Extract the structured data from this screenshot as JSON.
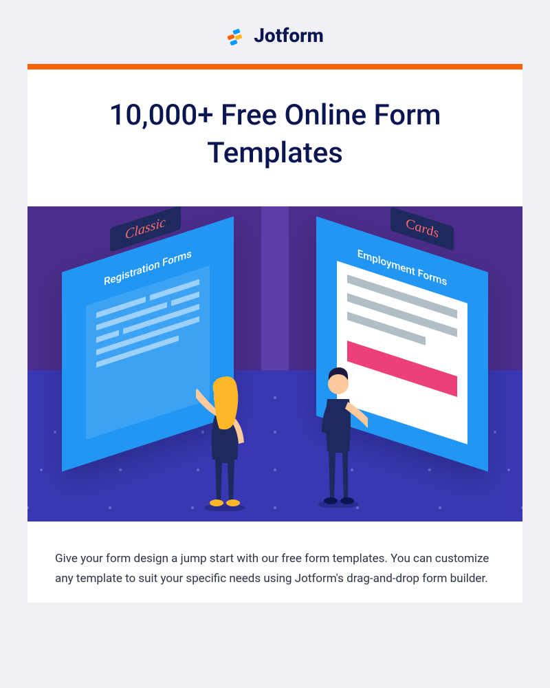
{
  "brand": {
    "name": "Jotform"
  },
  "hero": {
    "headline": "10,000+ Free Online Form Templates",
    "illustration": {
      "left_sign": "Classic",
      "right_sign": "Cards",
      "left_panel_label": "Registration Forms",
      "right_panel_label": "Employment Forms"
    }
  },
  "body": {
    "paragraph": "Give your form design a jump start with our free form templates. You can customize any template to suit your specific needs using Jotform's drag-and-drop form builder."
  },
  "colors": {
    "accent_orange": "#ff6100",
    "brand_navy": "#0a1551",
    "hero_purple": "#4c2d8c",
    "panel_blue": "#2196f3"
  }
}
